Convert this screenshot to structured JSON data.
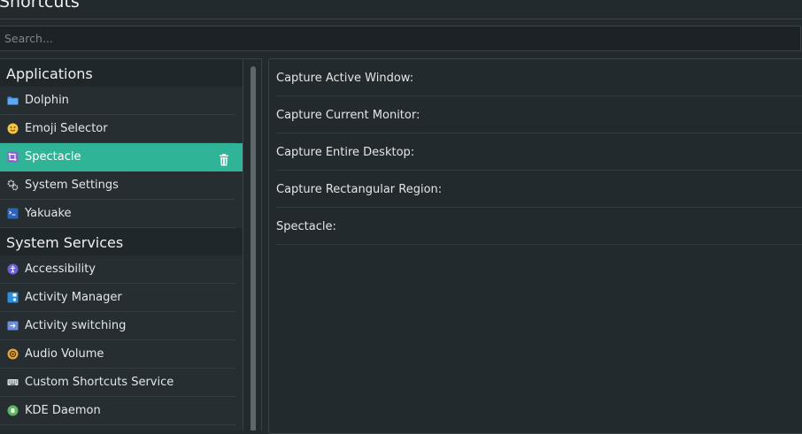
{
  "header": {
    "title": "Shortcuts"
  },
  "search": {
    "placeholder": "Search...",
    "value": ""
  },
  "sidebar": {
    "sections": [
      {
        "label": "Applications",
        "items": [
          {
            "label": "Dolphin",
            "icon": "folder-icon"
          },
          {
            "label": "Emoji Selector",
            "icon": "emoji-icon"
          },
          {
            "label": "Spectacle",
            "icon": "spectacle-icon",
            "selected": true
          },
          {
            "label": "System Settings",
            "icon": "settings-icon"
          },
          {
            "label": "Yakuake",
            "icon": "terminal-icon"
          }
        ]
      },
      {
        "label": "System Services",
        "items": [
          {
            "label": "Accessibility",
            "icon": "accessibility-icon"
          },
          {
            "label": "Activity Manager",
            "icon": "activity-manager-icon"
          },
          {
            "label": "Activity switching",
            "icon": "activity-switching-icon"
          },
          {
            "label": "Audio Volume",
            "icon": "audio-volume-icon"
          },
          {
            "label": "Custom Shortcuts Service",
            "icon": "keyboard-icon"
          },
          {
            "label": "KDE Daemon",
            "icon": "kde-daemon-icon"
          }
        ]
      }
    ]
  },
  "shortcuts": {
    "items": [
      {
        "label": "Capture Active Window:"
      },
      {
        "label": "Capture Current Monitor:"
      },
      {
        "label": "Capture Entire Desktop:"
      },
      {
        "label": "Capture Rectangular Region:"
      },
      {
        "label": "Spectacle:"
      }
    ]
  },
  "colors": {
    "accent": "#2fb497",
    "background": "#232a2e",
    "panel": "#262e32"
  }
}
